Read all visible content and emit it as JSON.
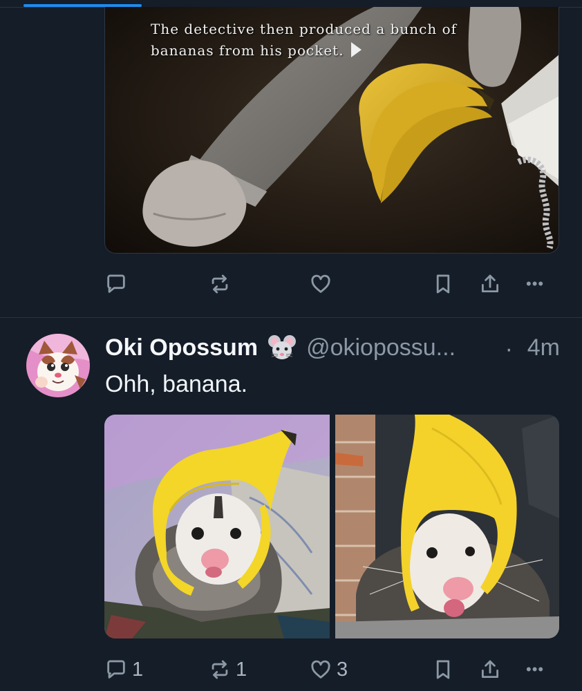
{
  "post_prev": {
    "media": {
      "caption_line1": "The detective then produced a bunch of",
      "caption_line2": "bananas from his pocket.",
      "image_description_icon": "game-screenshot-icon"
    },
    "actions": {
      "reply": {
        "icon": "reply-icon",
        "count": ""
      },
      "repost": {
        "icon": "repost-icon",
        "count": ""
      },
      "like": {
        "icon": "heart-icon",
        "count": ""
      },
      "bookmark": {
        "icon": "bookmark-icon"
      },
      "share": {
        "icon": "share-icon"
      },
      "more": {
        "icon": "more-icon",
        "label": "•••"
      }
    }
  },
  "post": {
    "author": {
      "display_name": "Oki Opossum",
      "badge_emoji": "mouse-face-icon",
      "handle": "@okiopossu...",
      "separator": "·",
      "time": "4m"
    },
    "text": "Ohh, banana.",
    "media": [
      "opossum-banana-hat-photo-1",
      "opossum-banana-hat-photo-2"
    ],
    "actions": {
      "reply": {
        "icon": "reply-icon",
        "count": "1"
      },
      "repost": {
        "icon": "repost-icon",
        "count": "1"
      },
      "like": {
        "icon": "heart-icon",
        "count": "3"
      },
      "bookmark": {
        "icon": "bookmark-icon"
      },
      "share": {
        "icon": "share-icon"
      },
      "more": {
        "icon": "more-icon",
        "label": "•••"
      }
    }
  },
  "colors": {
    "background": "#151d28",
    "divider": "#2a3441",
    "text_primary": "#f1f5f9",
    "text_secondary": "#8b98a5",
    "accent": "#1d8cf0"
  }
}
